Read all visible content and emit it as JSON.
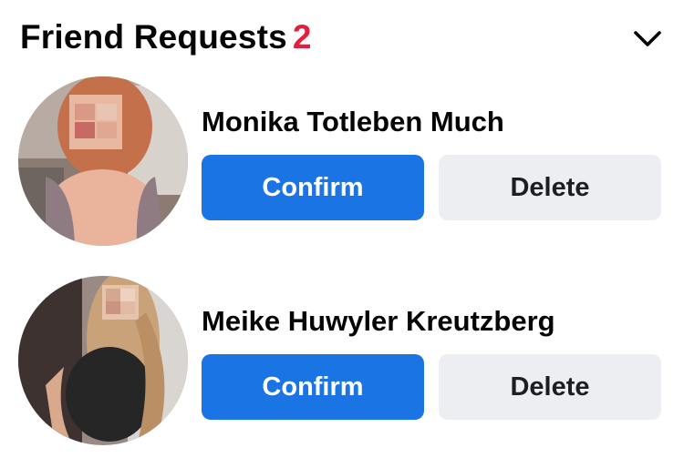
{
  "header": {
    "title": "Friend Requests",
    "count": "2",
    "collapse_icon": "chevron-down-icon"
  },
  "requests": [
    {
      "name": "Monika Totleben Much",
      "confirm_label": "Confirm",
      "delete_label": "Delete"
    },
    {
      "name": "Meike Huwyler Kreutzberg",
      "confirm_label": "Confirm",
      "delete_label": "Delete"
    }
  ],
  "colors": {
    "confirm_button": "#1b74e4",
    "delete_button": "#eceef1",
    "count_badge": "#e41e3f"
  }
}
